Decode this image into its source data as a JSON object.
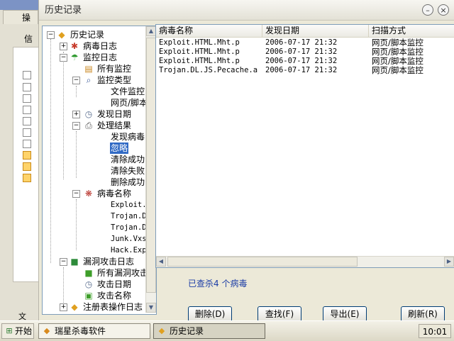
{
  "background_app": {
    "tab_label": "操",
    "tab2_label": "信",
    "bottom_text": "文"
  },
  "dialog": {
    "title": "历史记录"
  },
  "tree": {
    "root": "历史记录",
    "virus_log": "病毒日志",
    "monitor_log": "监控日志",
    "all_monitor": "所有监控",
    "monitor_type": "监控类型",
    "file_monitor": "文件监控",
    "web_script": "网页/脚本",
    "found_date": "发现日期",
    "process_result": "处理结果",
    "found_virus": "发现病毒",
    "ignore": "忽略",
    "clear_ok": "清除成功",
    "clear_fail": "清除失败",
    "delete_ok": "删除成功",
    "virus_name": "病毒名称",
    "vn1": "Exploit.",
    "vn2": "Trojan.D",
    "vn3": "Trojan.D",
    "vn4": "Junk.Vxs",
    "vn5": "Hack.Exp",
    "vuln_log": "漏洞攻击日志",
    "all_vuln": "所有漏洞攻击",
    "attack_date": "攻击日期",
    "attack_name": "攻击名称",
    "registry_log": "注册表操作日志"
  },
  "list": {
    "headers": [
      "病毒名称",
      "发现日期",
      "扫描方式"
    ],
    "rows": [
      {
        "name": "Exploit.HTML.Mht.p",
        "date": "2006-07-17 21:32",
        "method": "网页/脚本监控"
      },
      {
        "name": "Exploit.HTML.Mht.p",
        "date": "2006-07-17 21:32",
        "method": "网页/脚本监控"
      },
      {
        "name": "Exploit.HTML.Mht.p",
        "date": "2006-07-17 21:32",
        "method": "网页/脚本监控"
      },
      {
        "name": "Trojan.DL.JS.Pecache.a",
        "date": "2006-07-17 21:32",
        "method": "网页/脚本监控"
      }
    ]
  },
  "status_text": "已查杀4 个病毒",
  "buttons": {
    "delete": "删除(D)",
    "find": "查找(F)",
    "export": "导出(E)",
    "refresh": "刷新(R)"
  },
  "taskbar": {
    "start": "开始",
    "task1": "瑞星杀毒软件",
    "task2": "历史记录",
    "clock": "10:01"
  },
  "colors": {
    "window_bg": "#ECE9D8",
    "selection": "#316ac5",
    "status_text": "#1d3ea6",
    "border_blue": "#7f9db9"
  },
  "icons": [
    "app-icon",
    "minimize-icon",
    "close-icon",
    "history-icon",
    "virus-log-icon",
    "monitor-icon",
    "page-icon",
    "magnifier-icon",
    "calendar-icon",
    "printer-icon",
    "bug-icon",
    "cube-icon",
    "clock-icon",
    "registry-icon",
    "start-icon",
    "rising-icon"
  ]
}
